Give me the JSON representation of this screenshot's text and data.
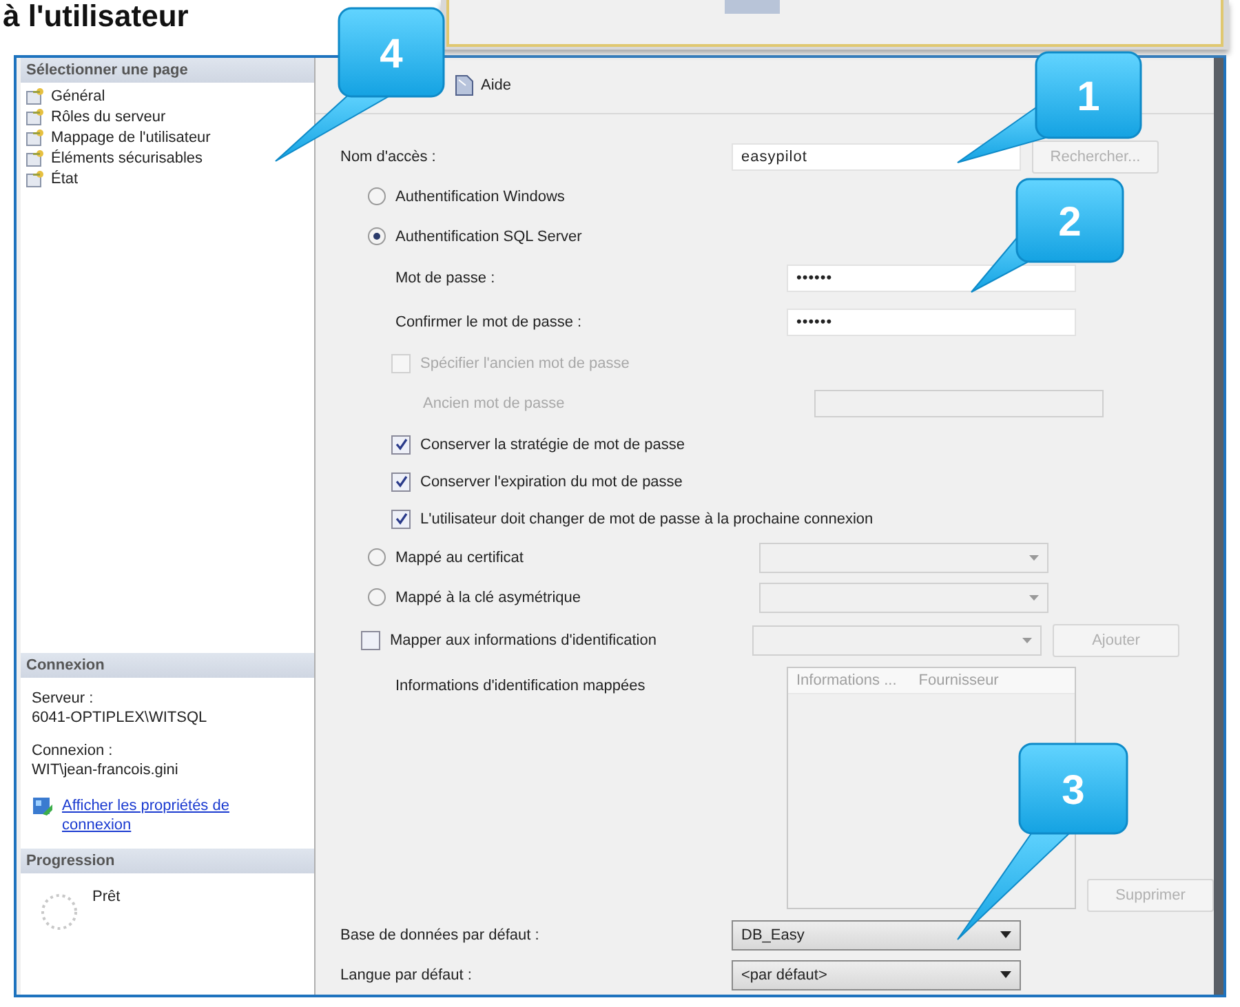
{
  "caption": "à l'utilisateur",
  "sidebar": {
    "header": "Sélectionner une page",
    "pages": [
      {
        "label": "Général",
        "selected": false
      },
      {
        "label": "Rôles du serveur",
        "selected": false
      },
      {
        "label": "Mappage de l'utilisateur",
        "selected": false
      },
      {
        "label": "Éléments sécurisables",
        "selected": false
      },
      {
        "label": "État",
        "selected": false
      }
    ]
  },
  "connection": {
    "header": "Connexion",
    "server_label": "Serveur :",
    "server": "6041-OPTIPLEX\\WITSQL",
    "login_label": "Connexion :",
    "login": "WIT\\jean-francois.gini",
    "link": "Afficher les propriétés de connexion"
  },
  "progress": {
    "header": "Progression",
    "status": "Prêt"
  },
  "toolbar": {
    "help": "Aide"
  },
  "form": [
    {
      "kind": "field",
      "label": "Nom d'accès :",
      "value": "easypilot",
      "button": {
        "label": "Rechercher...",
        "disabled": true
      }
    },
    {
      "kind": "radio",
      "label": "Authentification Windows",
      "selected": false
    },
    {
      "kind": "radio",
      "label": "Authentification SQL Server",
      "selected": true
    },
    {
      "kind": "subfield",
      "label": "Mot de passe :",
      "value": "••••••",
      "disabled": false
    },
    {
      "kind": "subfield",
      "label": "Confirmer le mot de passe :",
      "value": "••••••",
      "disabled": false
    },
    {
      "kind": "subcheck",
      "label": "Spécifier l'ancien mot de passe",
      "checked": false,
      "disabled": true
    },
    {
      "kind": "deepfield",
      "label": "Ancien mot de passe",
      "disabled": true
    },
    {
      "kind": "subcheck",
      "label": "Conserver la stratégie de mot de passe",
      "checked": true,
      "disabled": false
    },
    {
      "kind": "subcheck",
      "label": "Conserver l'expiration du mot de passe",
      "checked": true,
      "disabled": false
    },
    {
      "kind": "subcheck",
      "label": "L'utilisateur doit changer de mot de passe à la prochaine connexion",
      "checked": true,
      "disabled": false
    },
    {
      "kind": "radio",
      "label": "Mappé au certificat",
      "selected": false,
      "dropdown": true
    },
    {
      "kind": "radio",
      "label": "Mappé à la clé asymétrique",
      "selected": false,
      "dropdown": true
    },
    {
      "kind": "check",
      "label": "Mapper aux informations d'identification",
      "checked": false,
      "disabled": false,
      "dropdown": true,
      "button": {
        "label": "Ajouter",
        "disabled": true
      }
    },
    {
      "kind": "list",
      "label": "Informations d'identification mappées",
      "columns": [
        "Informations ...",
        "Fournisseur"
      ],
      "button": {
        "label": "Supprimer",
        "disabled": true
      }
    },
    {
      "kind": "combo",
      "label": "Base de données par défaut :",
      "value": "DB_Easy"
    },
    {
      "kind": "combo",
      "label": "Langue par défaut :",
      "value": "<par défaut>"
    }
  ],
  "callouts": [
    "4",
    "1",
    "2",
    "3"
  ]
}
